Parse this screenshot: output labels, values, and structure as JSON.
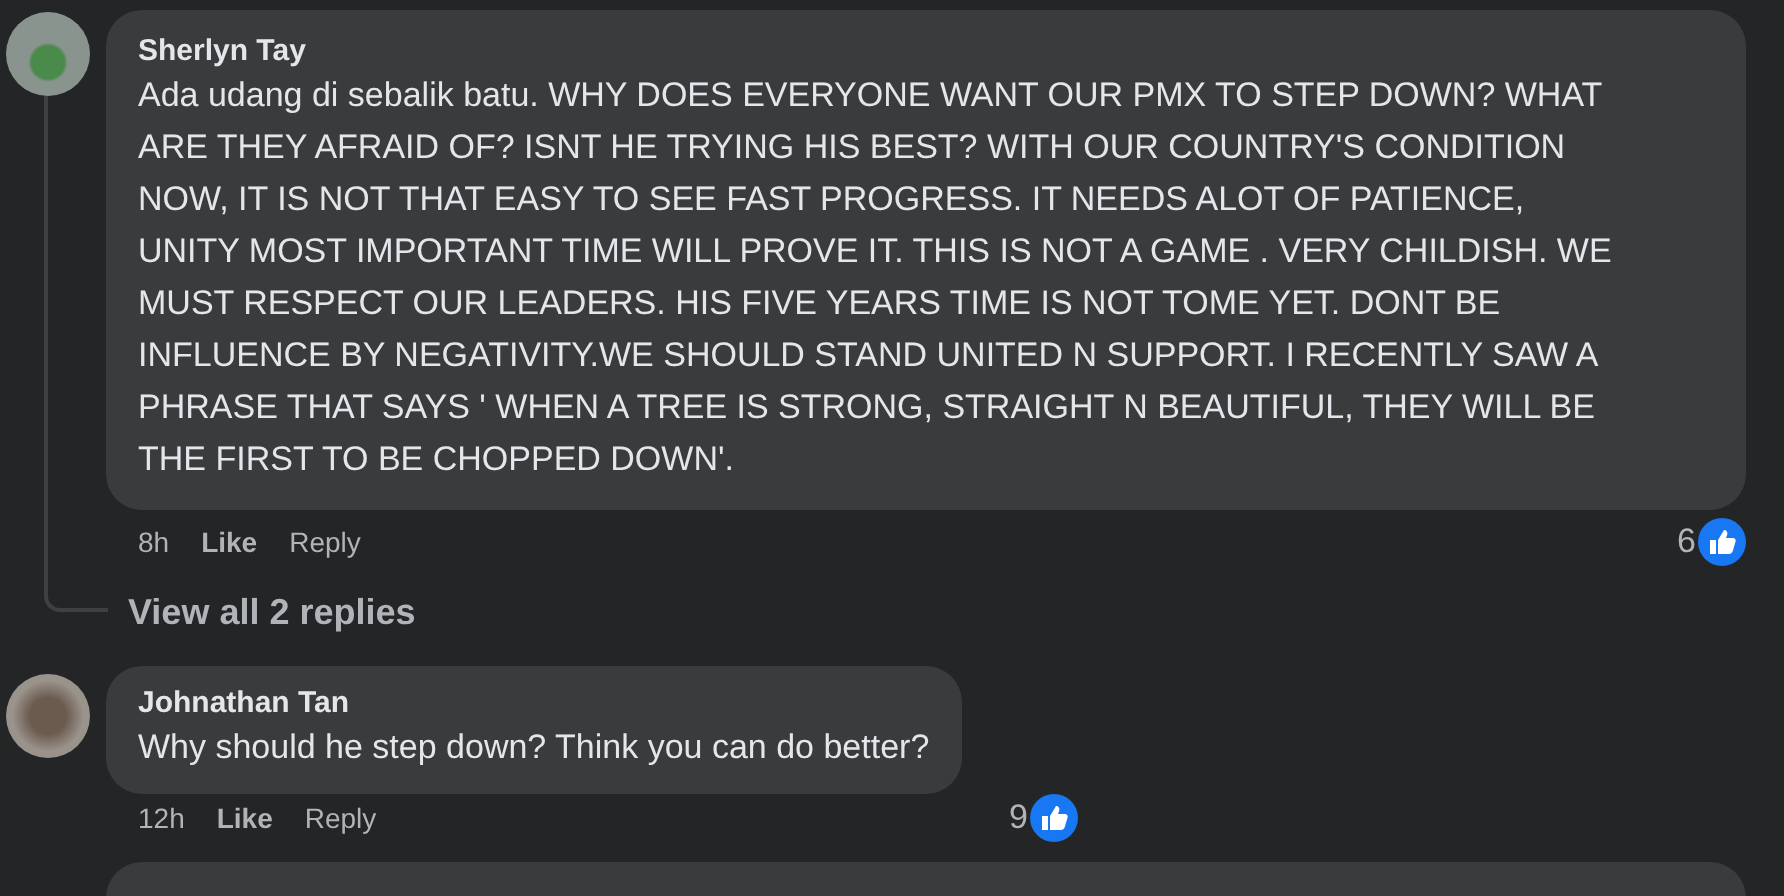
{
  "comments": [
    {
      "author": "Sherlyn Tay",
      "text": "Ada udang di sebalik batu. WHY DOES EVERYONE WANT OUR PMX TO STEP DOWN? WHAT ARE THEY AFRAID OF? ISNT HE TRYING HIS BEST? WITH OUR COUNTRY'S CONDITION NOW, IT IS NOT THAT EASY TO SEE FAST PROGRESS. IT NEEDS ALOT OF PATIENCE, UNITY MOST IMPORTANT TIME WILL PROVE IT. THIS IS NOT A GAME . VERY CHILDISH. WE MUST RESPECT OUR LEADERS. HIS FIVE YEARS TIME IS NOT TOME YET. DONT BE INFLUENCE BY NEGATIVITY.WE SHOULD STAND UNITED N SUPPORT. I RECENTLY SAW A PHRASE THAT SAYS ' WHEN A TREE IS STRONG, STRAIGHT N BEAUTIFUL, THEY WILL BE THE FIRST TO BE CHOPPED DOWN'.",
      "time": "8h",
      "like": "Like",
      "reply": "Reply",
      "likes": "6",
      "replies_link": "View all 2 replies"
    },
    {
      "author": "Johnathan Tan",
      "text": "Why should he step down? Think you can do better?",
      "time": "12h",
      "like": "Like",
      "reply": "Reply",
      "likes": "9"
    }
  ]
}
